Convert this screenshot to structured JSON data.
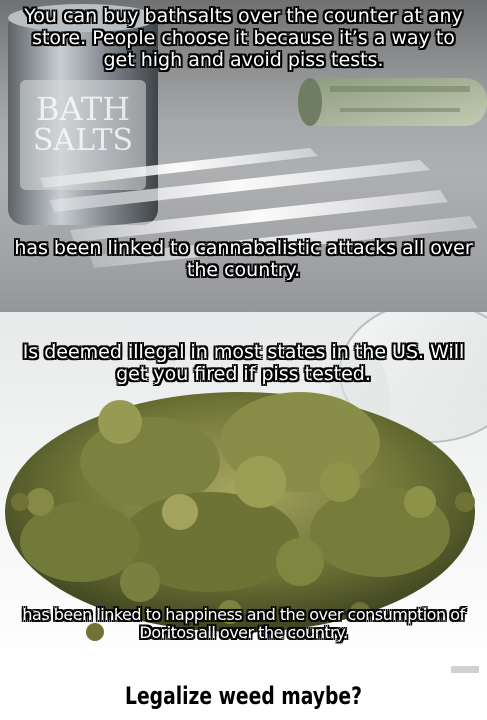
{
  "top_panel": {
    "caption_1": "You can buy bathsalts over the counter at any store. People choose it because it’s a way to get high and avoid piss tests.",
    "caption_2": "has been linked to cannabalistic attacks all over the country.",
    "jar_label": "BATH SALTS"
  },
  "bottom_panel": {
    "caption_1": "Is deemed illegal in most states in the US. Will get you fired if piss tested.",
    "caption_2": "has been linked to happiness and the over consumption of Doritos all over the country."
  },
  "footer": {
    "text": "Legalize weed maybe?"
  }
}
